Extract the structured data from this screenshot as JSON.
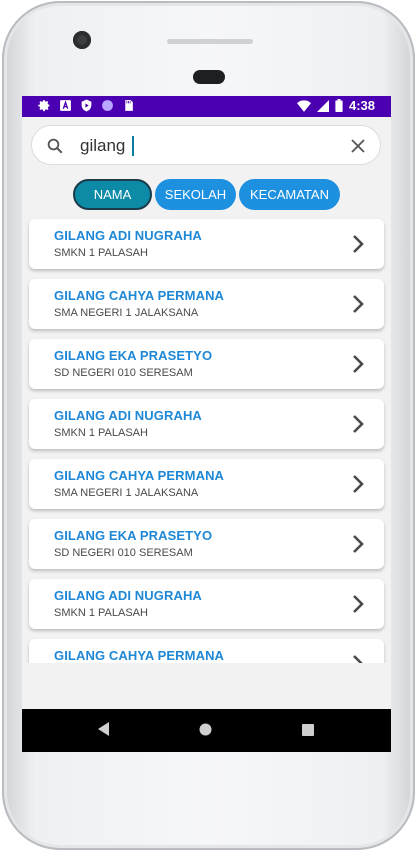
{
  "statusbar": {
    "time": "4:38",
    "icons": [
      "settings-icon",
      "a-icon",
      "play-protect-icon",
      "circle-icon",
      "sd-card-icon"
    ]
  },
  "search": {
    "value": "gilang",
    "placeholder": ""
  },
  "filters": [
    {
      "label": "NAMA",
      "active": true
    },
    {
      "label": "SEKOLAH",
      "active": false
    },
    {
      "label": "KECAMATAN",
      "active": false
    }
  ],
  "results": [
    {
      "name": "GILANG ADI NUGRAHA",
      "school": "SMKN 1 PALASAH"
    },
    {
      "name": "GILANG CAHYA PERMANA",
      "school": "SMA NEGERI 1 JALAKSANA"
    },
    {
      "name": "GILANG EKA PRASETYO",
      "school": "SD NEGERI 010 SERESAM"
    },
    {
      "name": "GILANG ADI NUGRAHA",
      "school": "SMKN 1 PALASAH"
    },
    {
      "name": "GILANG CAHYA PERMANA",
      "school": "SMA NEGERI 1 JALAKSANA"
    },
    {
      "name": "GILANG EKA PRASETYO",
      "school": "SD NEGERI 010 SERESAM"
    },
    {
      "name": "GILANG ADI NUGRAHA",
      "school": "SMKN 1 PALASAH"
    },
    {
      "name": "GILANG CAHYA PERMANA",
      "school": ""
    }
  ],
  "colors": {
    "statusbar": "#4a00b0",
    "accent": "#1e88d6",
    "chip": "#1e90e0",
    "chip_active": "#0c8aa6"
  }
}
